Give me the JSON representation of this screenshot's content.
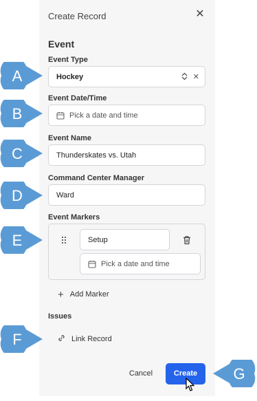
{
  "dialog": {
    "title": "Create Record",
    "section_title": "Event"
  },
  "fields": {
    "event_type": {
      "label": "Event Type",
      "value": "Hockey"
    },
    "event_datetime": {
      "label": "Event Date/Time",
      "placeholder": "Pick a date and time"
    },
    "event_name": {
      "label": "Event Name",
      "value": "Thunderskates vs. Utah"
    },
    "command_center_manager": {
      "label": "Command Center Manager",
      "value": "Ward"
    }
  },
  "event_markers": {
    "label": "Event Markers",
    "items": [
      {
        "value": "Setup",
        "date_placeholder": "Pick a date and time"
      }
    ],
    "add_label": "Add Marker"
  },
  "issues": {
    "label": "Issues",
    "link_label": "Link Record"
  },
  "actions": {
    "cancel_label": "Cancel",
    "create_label": "Create"
  },
  "callouts": [
    "A",
    "B",
    "C",
    "D",
    "E",
    "F",
    "G"
  ],
  "colors": {
    "accent": "#2563eb",
    "callout": "#5b9bd5",
    "panel_bg": "#f6f6f7"
  },
  "icons": [
    "close-icon",
    "chevron-up-down-icon",
    "clear-icon",
    "calendar-icon",
    "drag-handle-icon",
    "trash-icon",
    "plus-icon",
    "link-icon",
    "mouse-cursor-icon"
  ]
}
